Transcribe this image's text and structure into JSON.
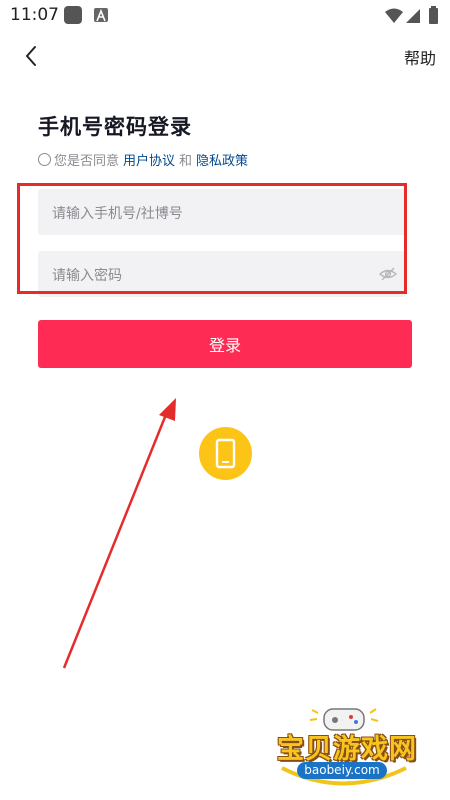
{
  "status_bar": {
    "time": "11:07"
  },
  "header": {
    "help_label": "帮助"
  },
  "title": "手机号密码登录",
  "agreement": {
    "prefix": "您是否同意",
    "user_agreement": "用户协议",
    "and": "和",
    "privacy_policy": "隐私政策"
  },
  "form": {
    "phone_placeholder": "请输入手机号/社博号",
    "password_placeholder": "请输入密码"
  },
  "login_label": "登录",
  "watermark": {
    "text": "宝贝游戏网",
    "url": "baobeiy.com"
  },
  "colors": {
    "primary": "#fe2c55",
    "link": "#04498d",
    "highlight": "#e62b2b",
    "phone_icon_bg": "#fcc417"
  }
}
